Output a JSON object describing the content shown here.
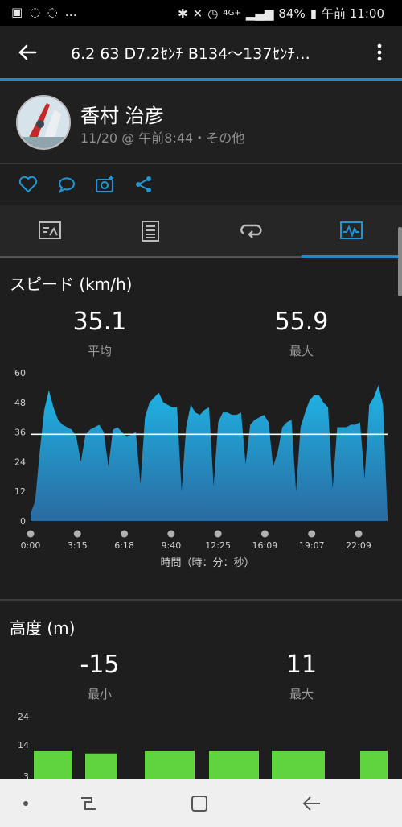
{
  "status_bar": {
    "left_icons": "▣ ◌ ◌ …",
    "battery": "84%",
    "network": "4G+",
    "time": "午前 11:00"
  },
  "header": {
    "title": "6.2  63  D7.2ｾﾝﾁ  B134～137ｾﾝﾁ…"
  },
  "profile": {
    "name": "香村 治彦",
    "meta": "11/20 @ 午前8:44・その他"
  },
  "speed": {
    "title": "スピード (km/h)",
    "avg_value": "35.1",
    "avg_label": "平均",
    "max_value": "55.9",
    "max_label": "最大"
  },
  "altitude": {
    "title": "高度 (m)",
    "min_value": "-15",
    "min_label": "最小",
    "max_value": "11",
    "max_label": "最大"
  },
  "chart_data": [
    {
      "type": "area",
      "y_ticks": [
        "60",
        "48",
        "36",
        "24",
        "12",
        "0"
      ],
      "ylim": [
        0,
        60
      ],
      "x_tick_labels": [
        "0:00",
        "3:15",
        "6:18",
        "9:40",
        "12:25",
        "16:09",
        "19:07",
        "22:09"
      ],
      "xlabel": "時間（時：分：秒）",
      "average_line": 35.1,
      "series_color": "#1fa7d8",
      "values": [
        3,
        8,
        28,
        45,
        53,
        46,
        41,
        39,
        38,
        37,
        34,
        24,
        35,
        37,
        38,
        39,
        36,
        22,
        37,
        38,
        36,
        34,
        35,
        36,
        15,
        42,
        48,
        50,
        52,
        48,
        47,
        46,
        46,
        12,
        38,
        47,
        44,
        43,
        45,
        46,
        14,
        40,
        44,
        44,
        43,
        43,
        44,
        23,
        39,
        41,
        42,
        43,
        40,
        22,
        28,
        38,
        40,
        41,
        12,
        38,
        44,
        49,
        51,
        51,
        48,
        46,
        13,
        38,
        38,
        38,
        39,
        39,
        40,
        17,
        47,
        50,
        55,
        47,
        2
      ]
    },
    {
      "type": "area",
      "y_ticks": [
        "24",
        "14",
        "3"
      ],
      "ylim": [
        3,
        24
      ],
      "series_color": "#5fd43e",
      "segments": [
        [
          12,
          12,
          12,
          12,
          12,
          12,
          12
        ],
        [
          11,
          11,
          11,
          11
        ],
        [
          12,
          12,
          12,
          12,
          12,
          12,
          12,
          12
        ],
        [
          12,
          12,
          12,
          12,
          12,
          12,
          12,
          12,
          12,
          12,
          12
        ],
        [
          12,
          12,
          12,
          12,
          12,
          12,
          12,
          12,
          12,
          12,
          12
        ],
        [
          12,
          12,
          12,
          12
        ]
      ]
    }
  ]
}
